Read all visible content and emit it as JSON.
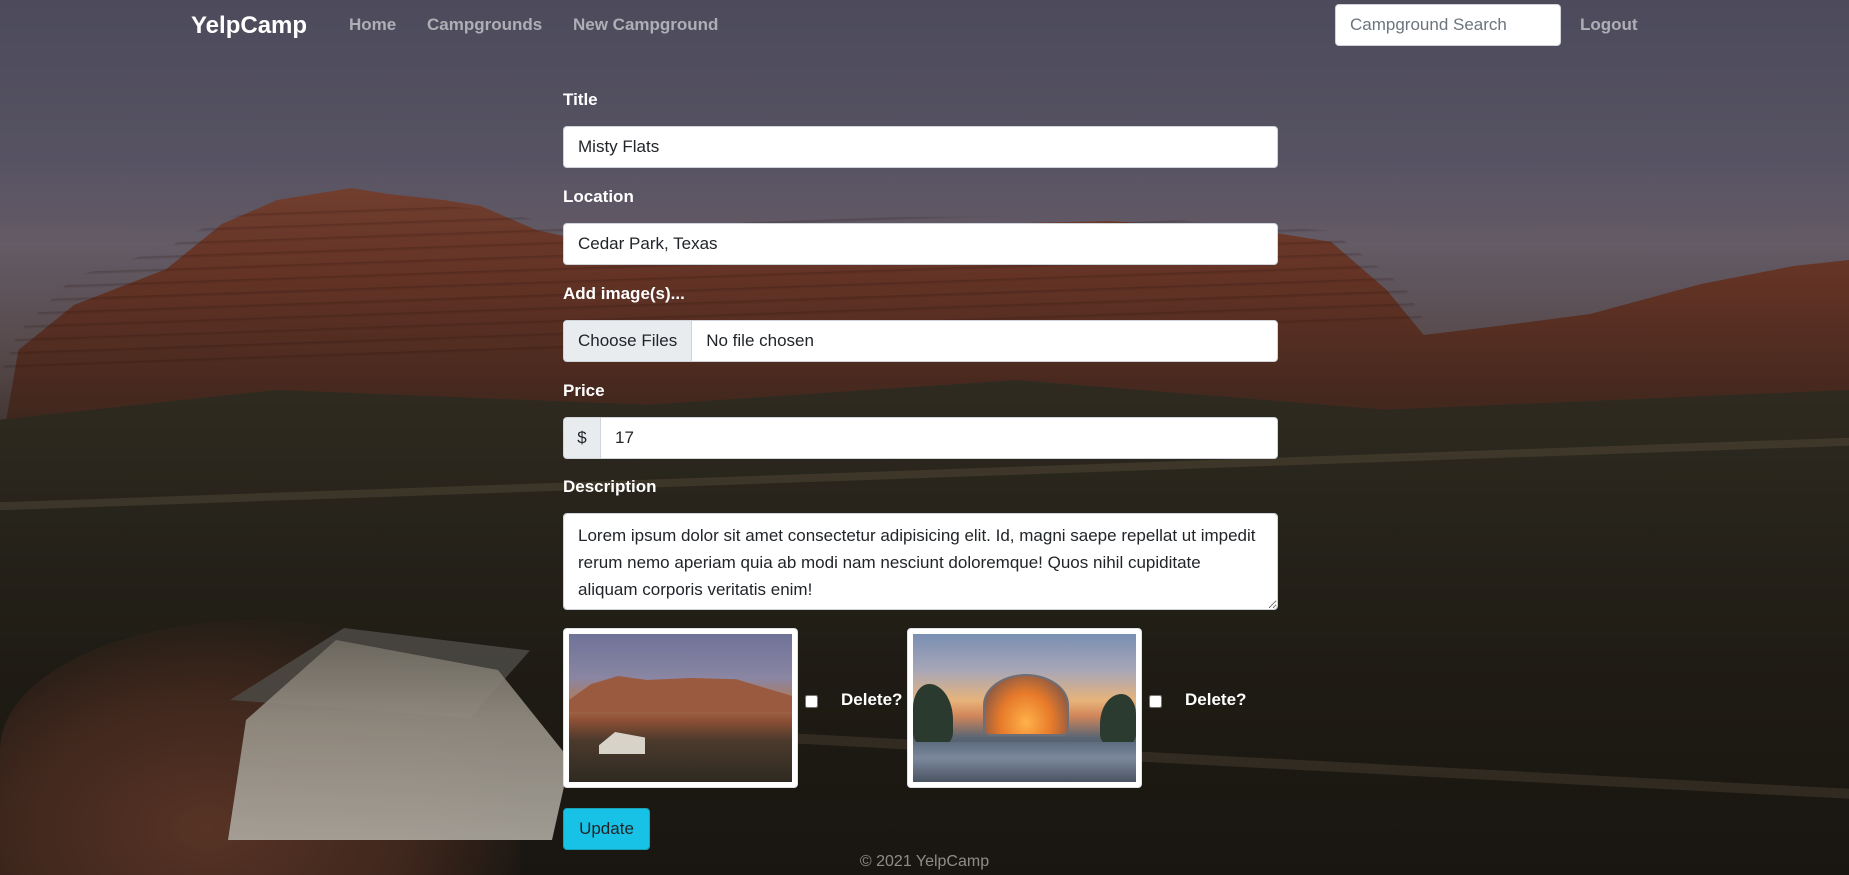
{
  "navbar": {
    "brand": "YelpCamp",
    "links": [
      "Home",
      "Campgrounds",
      "New Campground"
    ],
    "search_placeholder": "Campground Search",
    "logout": "Logout"
  },
  "form": {
    "title_label": "Title",
    "title_value": "Misty Flats",
    "location_label": "Location",
    "location_value": "Cedar Park, Texas",
    "images_label": "Add image(s)...",
    "file_button": "Choose Files",
    "file_status": "No file chosen",
    "price_label": "Price",
    "price_addon": "$",
    "price_value": "17",
    "description_label": "Description",
    "description_value": "Lorem ipsum dolor sit amet consectetur adipisicing elit. Id, magni saepe repellat ut impedit rerum nemo aperiam quia ab modi nam nesciunt doloremque! Quos nihil cupiditate aliquam corporis veritatis enim!",
    "images": [
      {
        "delete_label": "Delete?",
        "checked": false
      },
      {
        "delete_label": "Delete?",
        "checked": false
      }
    ],
    "submit": "Update"
  },
  "footer": "© 2021 YelpCamp",
  "colors": {
    "accent": "#17c2e6",
    "nav_link": "rgba(255,255,255,0.55)"
  }
}
